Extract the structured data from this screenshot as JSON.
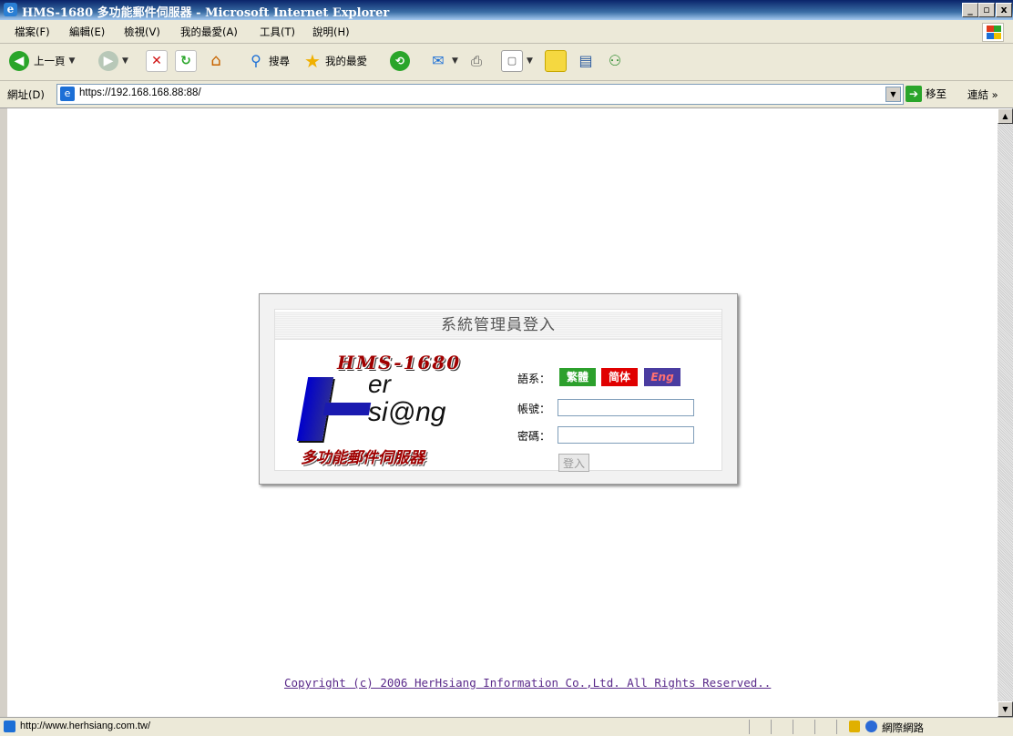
{
  "window": {
    "title": "HMS-1680 多功能郵件伺服器 - Microsoft Internet Explorer",
    "min_label": "_",
    "max_label": "▫",
    "close_label": "x"
  },
  "menu": {
    "items": [
      "檔案(F)",
      "編輯(E)",
      "檢視(V)",
      "我的最愛(A)",
      "工具(T)",
      "說明(H)"
    ]
  },
  "toolbar": {
    "back_label": "上一頁",
    "search_label": "搜尋",
    "favorites_label": "我的最愛"
  },
  "address": {
    "label": "網址(D)",
    "url": "https://192.168.168.88:88/",
    "go_label": "移至",
    "links_label": "連結 »"
  },
  "login": {
    "title": "系統管理員登入",
    "language_label": "語系：",
    "lang_options": [
      "繁體",
      "简体",
      "Eng"
    ],
    "account_label": "帳號：",
    "account_value": "",
    "password_label": "密碼：",
    "password_value": "",
    "submit_label": "登入"
  },
  "logo": {
    "model": "HMS-1680",
    "line1": "er",
    "line2": "si@ng",
    "subtitle": "多功能郵件伺服器"
  },
  "footer": {
    "copyright": "Copyright (c) 2006 HerHsiang Information Co.,Ltd. All Rights Reserved.."
  },
  "status": {
    "text": "http://www.herhsiang.com.tw/",
    "zone": "網際網路"
  },
  "colors": {
    "lang_trad": "#2ca02c",
    "lang_simp": "#e00000",
    "lang_eng": "#4a3ca0",
    "title_bar": "#0a246a"
  }
}
